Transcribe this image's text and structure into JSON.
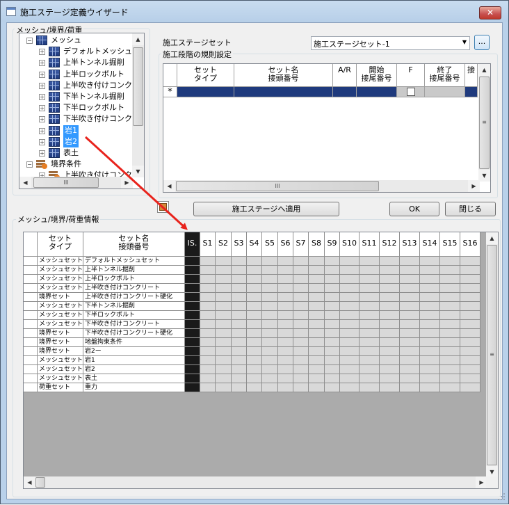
{
  "window": {
    "title": "施工ステージ定義ウイザード",
    "close_label": "✕"
  },
  "left_group": {
    "label": "メッシュ/境界/荷重",
    "tree": [
      {
        "label": "メッシュ",
        "icon": "mesh-icon",
        "level": 0,
        "expander": "−",
        "selected": false
      },
      {
        "label": "デフォルトメッシュセッ",
        "icon": "mesh-icon",
        "level": 1,
        "expander": "+",
        "selected": false
      },
      {
        "label": "上半トンネル掘削",
        "icon": "mesh-icon",
        "level": 1,
        "expander": "+",
        "selected": false
      },
      {
        "label": "上半ロックボルト",
        "icon": "mesh-icon",
        "level": 1,
        "expander": "+",
        "selected": false
      },
      {
        "label": "上半吹き付けコンクリ",
        "icon": "mesh-icon",
        "level": 1,
        "expander": "+",
        "selected": false
      },
      {
        "label": "下半トンネル掘削",
        "icon": "mesh-icon",
        "level": 1,
        "expander": "+",
        "selected": false
      },
      {
        "label": "下半ロックボルト",
        "icon": "mesh-icon",
        "level": 1,
        "expander": "+",
        "selected": false
      },
      {
        "label": "下半吹き付けコンクリ",
        "icon": "mesh-icon",
        "level": 1,
        "expander": "+",
        "selected": false
      },
      {
        "label": "岩1",
        "icon": "mesh-icon",
        "level": 1,
        "expander": "+",
        "selected": true
      },
      {
        "label": "岩2",
        "icon": "mesh-icon",
        "level": 1,
        "expander": "+",
        "selected": true
      },
      {
        "label": "表土",
        "icon": "mesh-icon",
        "level": 1,
        "expander": "+",
        "selected": false
      },
      {
        "label": "境界条件",
        "icon": "boundary-icon",
        "level": 0,
        "expander": "−",
        "selected": false
      },
      {
        "label": "上半吹き付けコンク",
        "icon": "boundary-icon",
        "level": 1,
        "expander": "+",
        "selected": false
      }
    ],
    "hscroll_label": "III"
  },
  "stage_set": {
    "label": "施工ステージセット",
    "value": "施工ステージセット-1",
    "dots_label": "..."
  },
  "rules": {
    "label": "施工段階の規則設定",
    "columns": [
      "セット\nタイプ",
      "セット名\n接頭番号",
      "A/R",
      "開始\n接尾番号",
      "F",
      "終了\n接尾番号",
      "接"
    ],
    "new_row_marker": "*",
    "hscroll_label": "III"
  },
  "buttons": {
    "apply": "施工ステージへ適用",
    "ok": "OK",
    "close": "閉じる"
  },
  "info": {
    "label": "メッシュ/境界/荷重情報",
    "col_type": "セット\nタイプ",
    "col_name": "セット名\n接頭番号",
    "col_is": "IS.",
    "stages": [
      "S1",
      "S2",
      "S3",
      "S4",
      "S5",
      "S6",
      "S7",
      "S8",
      "S9",
      "S10",
      "S11",
      "S12",
      "S13",
      "S14",
      "S15",
      "S16"
    ],
    "rows": [
      {
        "type": "メッシュセット",
        "name": "デフォルトメッシュセット"
      },
      {
        "type": "メッシュセット",
        "name": "上半トンネル掘削"
      },
      {
        "type": "メッシュセット",
        "name": "上半ロックボルト"
      },
      {
        "type": "メッシュセット",
        "name": "上半吹き付けコンクリート"
      },
      {
        "type": "境界セット",
        "name": "上半吹き付けコンクリート硬化"
      },
      {
        "type": "メッシュセット",
        "name": "下半トンネル掘削"
      },
      {
        "type": "メッシュセット",
        "name": "下半ロックボルト"
      },
      {
        "type": "メッシュセット",
        "name": "下半吹き付けコンクリート"
      },
      {
        "type": "境界セット",
        "name": "下半吹き付けコンクリート硬化"
      },
      {
        "type": "境界セット",
        "name": "地盤拘束条件"
      },
      {
        "type": "境界セット",
        "name": "岩2ー"
      },
      {
        "type": "メッシュセット",
        "name": "岩1"
      },
      {
        "type": "メッシュセット",
        "name": "岩2"
      },
      {
        "type": "メッシュセット",
        "name": "表土"
      },
      {
        "type": "荷重セット",
        "name": "重力"
      }
    ]
  },
  "colors": {
    "selection": "#3399ff",
    "arrow": "#e8231c",
    "is_column": "#1a1a1a",
    "new_row": "#1f3a7d"
  }
}
